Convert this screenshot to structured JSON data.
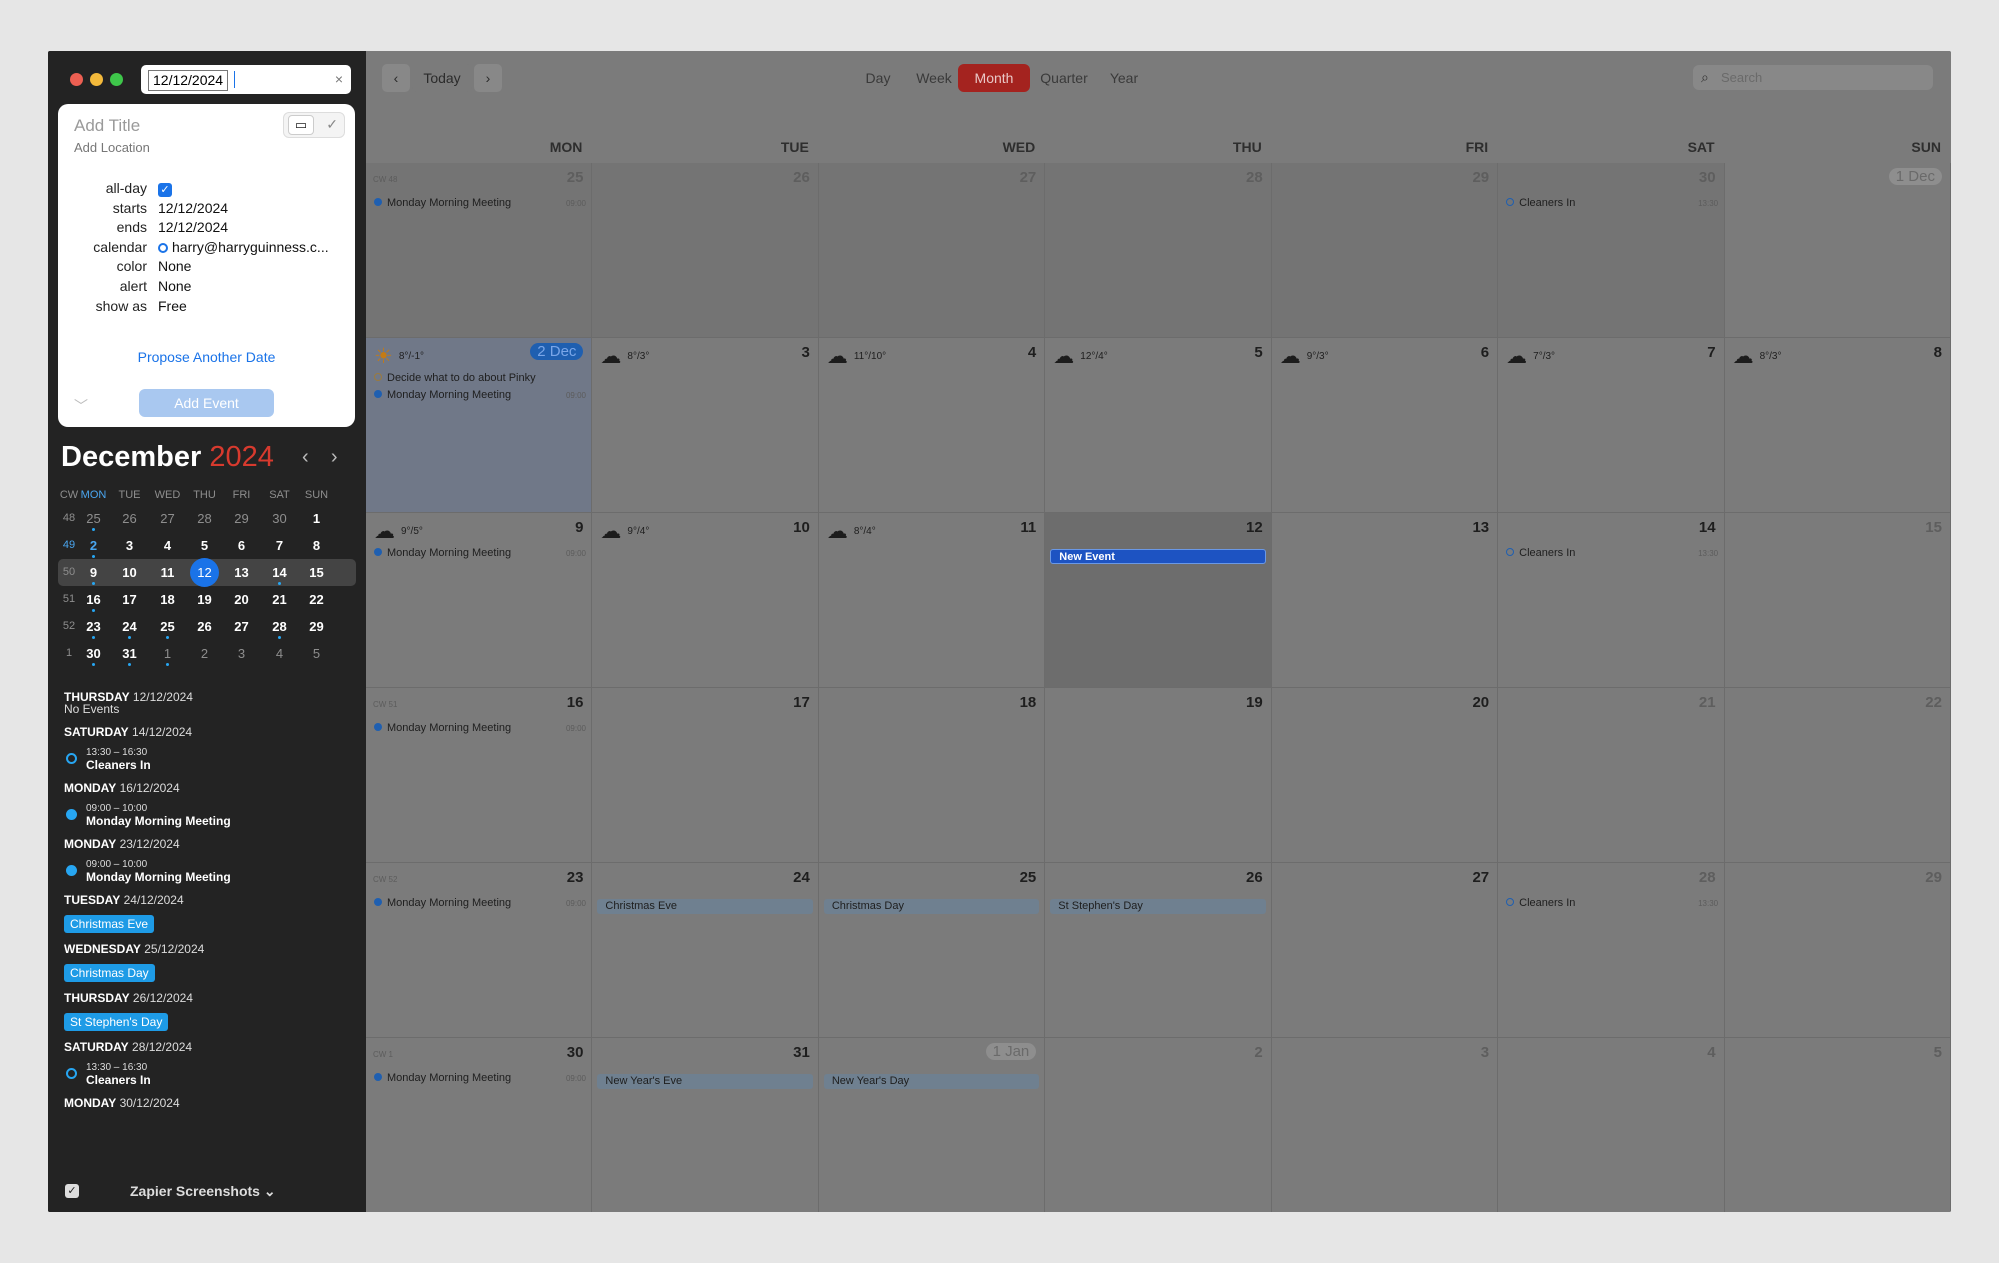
{
  "window": {
    "traffic_colors": [
      "#ec5f52",
      "#f3b93b",
      "#3ec64a"
    ]
  },
  "search_field": {
    "value": "12/12/2024",
    "clear_glyph": "×"
  },
  "new_event_popover": {
    "title_placeholder": "Add Title",
    "location_placeholder": "Add Location",
    "fields": [
      {
        "label": "all-day",
        "value": "✓"
      },
      {
        "label": "starts",
        "value": "12/12/2024"
      },
      {
        "label": "ends",
        "value": "12/12/2024"
      },
      {
        "label": "calendar",
        "value": "harry@harryguinness.c..."
      },
      {
        "label": "color",
        "value": "None"
      },
      {
        "label": "alert",
        "value": "None"
      },
      {
        "label": "show as",
        "value": "Free"
      }
    ],
    "propose_link": "Propose Another Date",
    "add_button": "Add Event",
    "collapse_glyph": "﹀"
  },
  "mini_calendar": {
    "month": "December",
    "year": "2024",
    "weekday_headers": [
      "CW",
      "MON",
      "TUE",
      "WED",
      "THU",
      "FRI",
      "SAT",
      "SUN"
    ],
    "weeks": [
      {
        "cw": "48",
        "days": [
          "25",
          "26",
          "27",
          "28",
          "29",
          "30",
          "1"
        ]
      },
      {
        "cw": "49",
        "days": [
          "2",
          "3",
          "4",
          "5",
          "6",
          "7",
          "8"
        ]
      },
      {
        "cw": "50",
        "days": [
          "9",
          "10",
          "11",
          "12",
          "13",
          "14",
          "15"
        ]
      },
      {
        "cw": "51",
        "days": [
          "16",
          "17",
          "18",
          "19",
          "20",
          "21",
          "22"
        ]
      },
      {
        "cw": "52",
        "days": [
          "23",
          "24",
          "25",
          "26",
          "27",
          "28",
          "29"
        ]
      },
      {
        "cw": "1",
        "days": [
          "30",
          "31",
          "1",
          "2",
          "3",
          "4",
          "5"
        ]
      }
    ],
    "today": "12"
  },
  "agenda": [
    {
      "day": "THURSDAY",
      "date": "12/12/2024",
      "none": "No Events"
    },
    {
      "day": "SATURDAY",
      "date": "14/12/2024",
      "events": [
        {
          "time": "13:30 – 16:30",
          "name": "Cleaners In",
          "outline": true
        }
      ]
    },
    {
      "day": "MONDAY",
      "date": "16/12/2024",
      "events": [
        {
          "time": "09:00 – 10:00",
          "name": "Monday Morning Meeting"
        }
      ]
    },
    {
      "day": "MONDAY",
      "date": "23/12/2024",
      "events": [
        {
          "time": "09:00 – 10:00",
          "name": "Monday Morning Meeting"
        }
      ]
    },
    {
      "day": "TUESDAY",
      "date": "24/12/2024",
      "pill": "Christmas Eve"
    },
    {
      "day": "WEDNESDAY",
      "date": "25/12/2024",
      "pill": "Christmas Day"
    },
    {
      "day": "THURSDAY",
      "date": "26/12/2024",
      "pill": "St Stephen's Day"
    },
    {
      "day": "SATURDAY",
      "date": "28/12/2024",
      "events": [
        {
          "time": "13:30 – 16:30",
          "name": "Cleaners In",
          "outline": true
        }
      ]
    },
    {
      "day": "MONDAY",
      "date": "30/12/2024"
    }
  ],
  "sidebar_footer": {
    "calendar_set": "Zapier Screenshots ⌄"
  },
  "toolbar": {
    "prev": "‹",
    "today": "Today",
    "next": "›",
    "views": [
      "Day",
      "Week",
      "Month",
      "Quarter",
      "Year"
    ],
    "active_view": "Month",
    "search_placeholder": "Search"
  },
  "month_grid": {
    "weekdays": [
      "MON",
      "TUE",
      "WED",
      "THU",
      "FRI",
      "SAT",
      "SUN"
    ],
    "weeks": [
      {
        "cw": "CW 48",
        "days": [
          {
            "n": "25",
            "dim": true,
            "events": [
              {
                "type": "ev",
                "name": "Monday Morning Meeting",
                "time": "09:00"
              }
            ]
          },
          {
            "n": "26",
            "dim": true
          },
          {
            "n": "27",
            "dim": true
          },
          {
            "n": "28",
            "dim": true
          },
          {
            "n": "29",
            "dim": true
          },
          {
            "n": "30",
            "dim": true,
            "events": [
              {
                "type": "ev",
                "name": "Cleaners In",
                "time": "13:30",
                "outline": true
              }
            ]
          },
          {
            "n": "1 Dec",
            "badge": "g"
          }
        ]
      },
      {
        "cw": "",
        "days": [
          {
            "n": "2 Dec",
            "badge": "b",
            "sel": true,
            "wx": "8°/-1°",
            "icon": "sun",
            "events": [
              {
                "type": "ev",
                "name": "Decide what to do about Pinky",
                "task": true
              },
              {
                "type": "ev",
                "name": "Monday Morning Meeting",
                "time": "09:00"
              }
            ]
          },
          {
            "n": "3",
            "wx": "8°/3°",
            "icon": "cloud"
          },
          {
            "n": "4",
            "wx": "11°/10°",
            "icon": "cloud"
          },
          {
            "n": "5",
            "wx": "12°/4°",
            "icon": "cloud"
          },
          {
            "n": "6",
            "wx": "9°/3°",
            "icon": "cloud"
          },
          {
            "n": "7",
            "wx": "7°/3°",
            "icon": "cloud"
          },
          {
            "n": "8",
            "wx": "8°/3°",
            "icon": "cloud"
          }
        ]
      },
      {
        "cw": "",
        "days": [
          {
            "n": "9",
            "wx": "9°/5°",
            "icon": "cloud",
            "events": [
              {
                "type": "ev",
                "name": "Monday Morning Meeting",
                "time": "09:00"
              }
            ]
          },
          {
            "n": "10",
            "wx": "9°/4°",
            "icon": "cloud"
          },
          {
            "n": "11",
            "wx": "8°/4°",
            "icon": "cloud"
          },
          {
            "n": "12",
            "sel": true,
            "events": [
              {
                "type": "bar",
                "name": "New Event",
                "new": true
              }
            ]
          },
          {
            "n": "13"
          },
          {
            "n": "14",
            "events": [
              {
                "type": "ev",
                "name": "Cleaners In",
                "time": "13:30",
                "outline": true
              }
            ]
          },
          {
            "n": "15",
            "dim": true
          }
        ]
      },
      {
        "cw": "CW 51",
        "days": [
          {
            "n": "16",
            "events": [
              {
                "type": "ev",
                "name": "Monday Morning Meeting",
                "time": "09:00"
              }
            ]
          },
          {
            "n": "17"
          },
          {
            "n": "18"
          },
          {
            "n": "19"
          },
          {
            "n": "20"
          },
          {
            "n": "21",
            "dim": true
          },
          {
            "n": "22",
            "dim": true
          }
        ]
      },
      {
        "cw": "CW 52",
        "days": [
          {
            "n": "23",
            "events": [
              {
                "type": "ev",
                "name": "Monday Morning Meeting",
                "time": "09:00"
              }
            ]
          },
          {
            "n": "24",
            "events": [
              {
                "type": "bar",
                "name": "Christmas Eve"
              }
            ]
          },
          {
            "n": "25",
            "events": [
              {
                "type": "bar",
                "name": "Christmas Day"
              }
            ]
          },
          {
            "n": "26",
            "events": [
              {
                "type": "bar",
                "name": "St Stephen's Day"
              }
            ]
          },
          {
            "n": "27"
          },
          {
            "n": "28",
            "dim": true,
            "events": [
              {
                "type": "ev",
                "name": "Cleaners In",
                "time": "13:30",
                "outline": true
              }
            ]
          },
          {
            "n": "29",
            "dim": true
          }
        ]
      },
      {
        "cw": "CW 1",
        "days": [
          {
            "n": "30",
            "events": [
              {
                "type": "ev",
                "name": "Monday Morning Meeting",
                "time": "09:00"
              }
            ]
          },
          {
            "n": "31",
            "events": [
              {
                "type": "bar",
                "name": "New Year's Eve"
              }
            ]
          },
          {
            "n": "1 Jan",
            "badge": "g",
            "events": [
              {
                "type": "bar",
                "name": "New Year's Day"
              }
            ]
          },
          {
            "n": "2",
            "dim": true
          },
          {
            "n": "3",
            "dim": true
          },
          {
            "n": "4",
            "dim": true
          },
          {
            "n": "5",
            "dim": true
          }
        ]
      }
    ]
  },
  "colors": {
    "accent": "#1a73e8",
    "active_tab": "#a4231f",
    "event_dot": "#1f5fb0",
    "year": "#d73a2e"
  }
}
